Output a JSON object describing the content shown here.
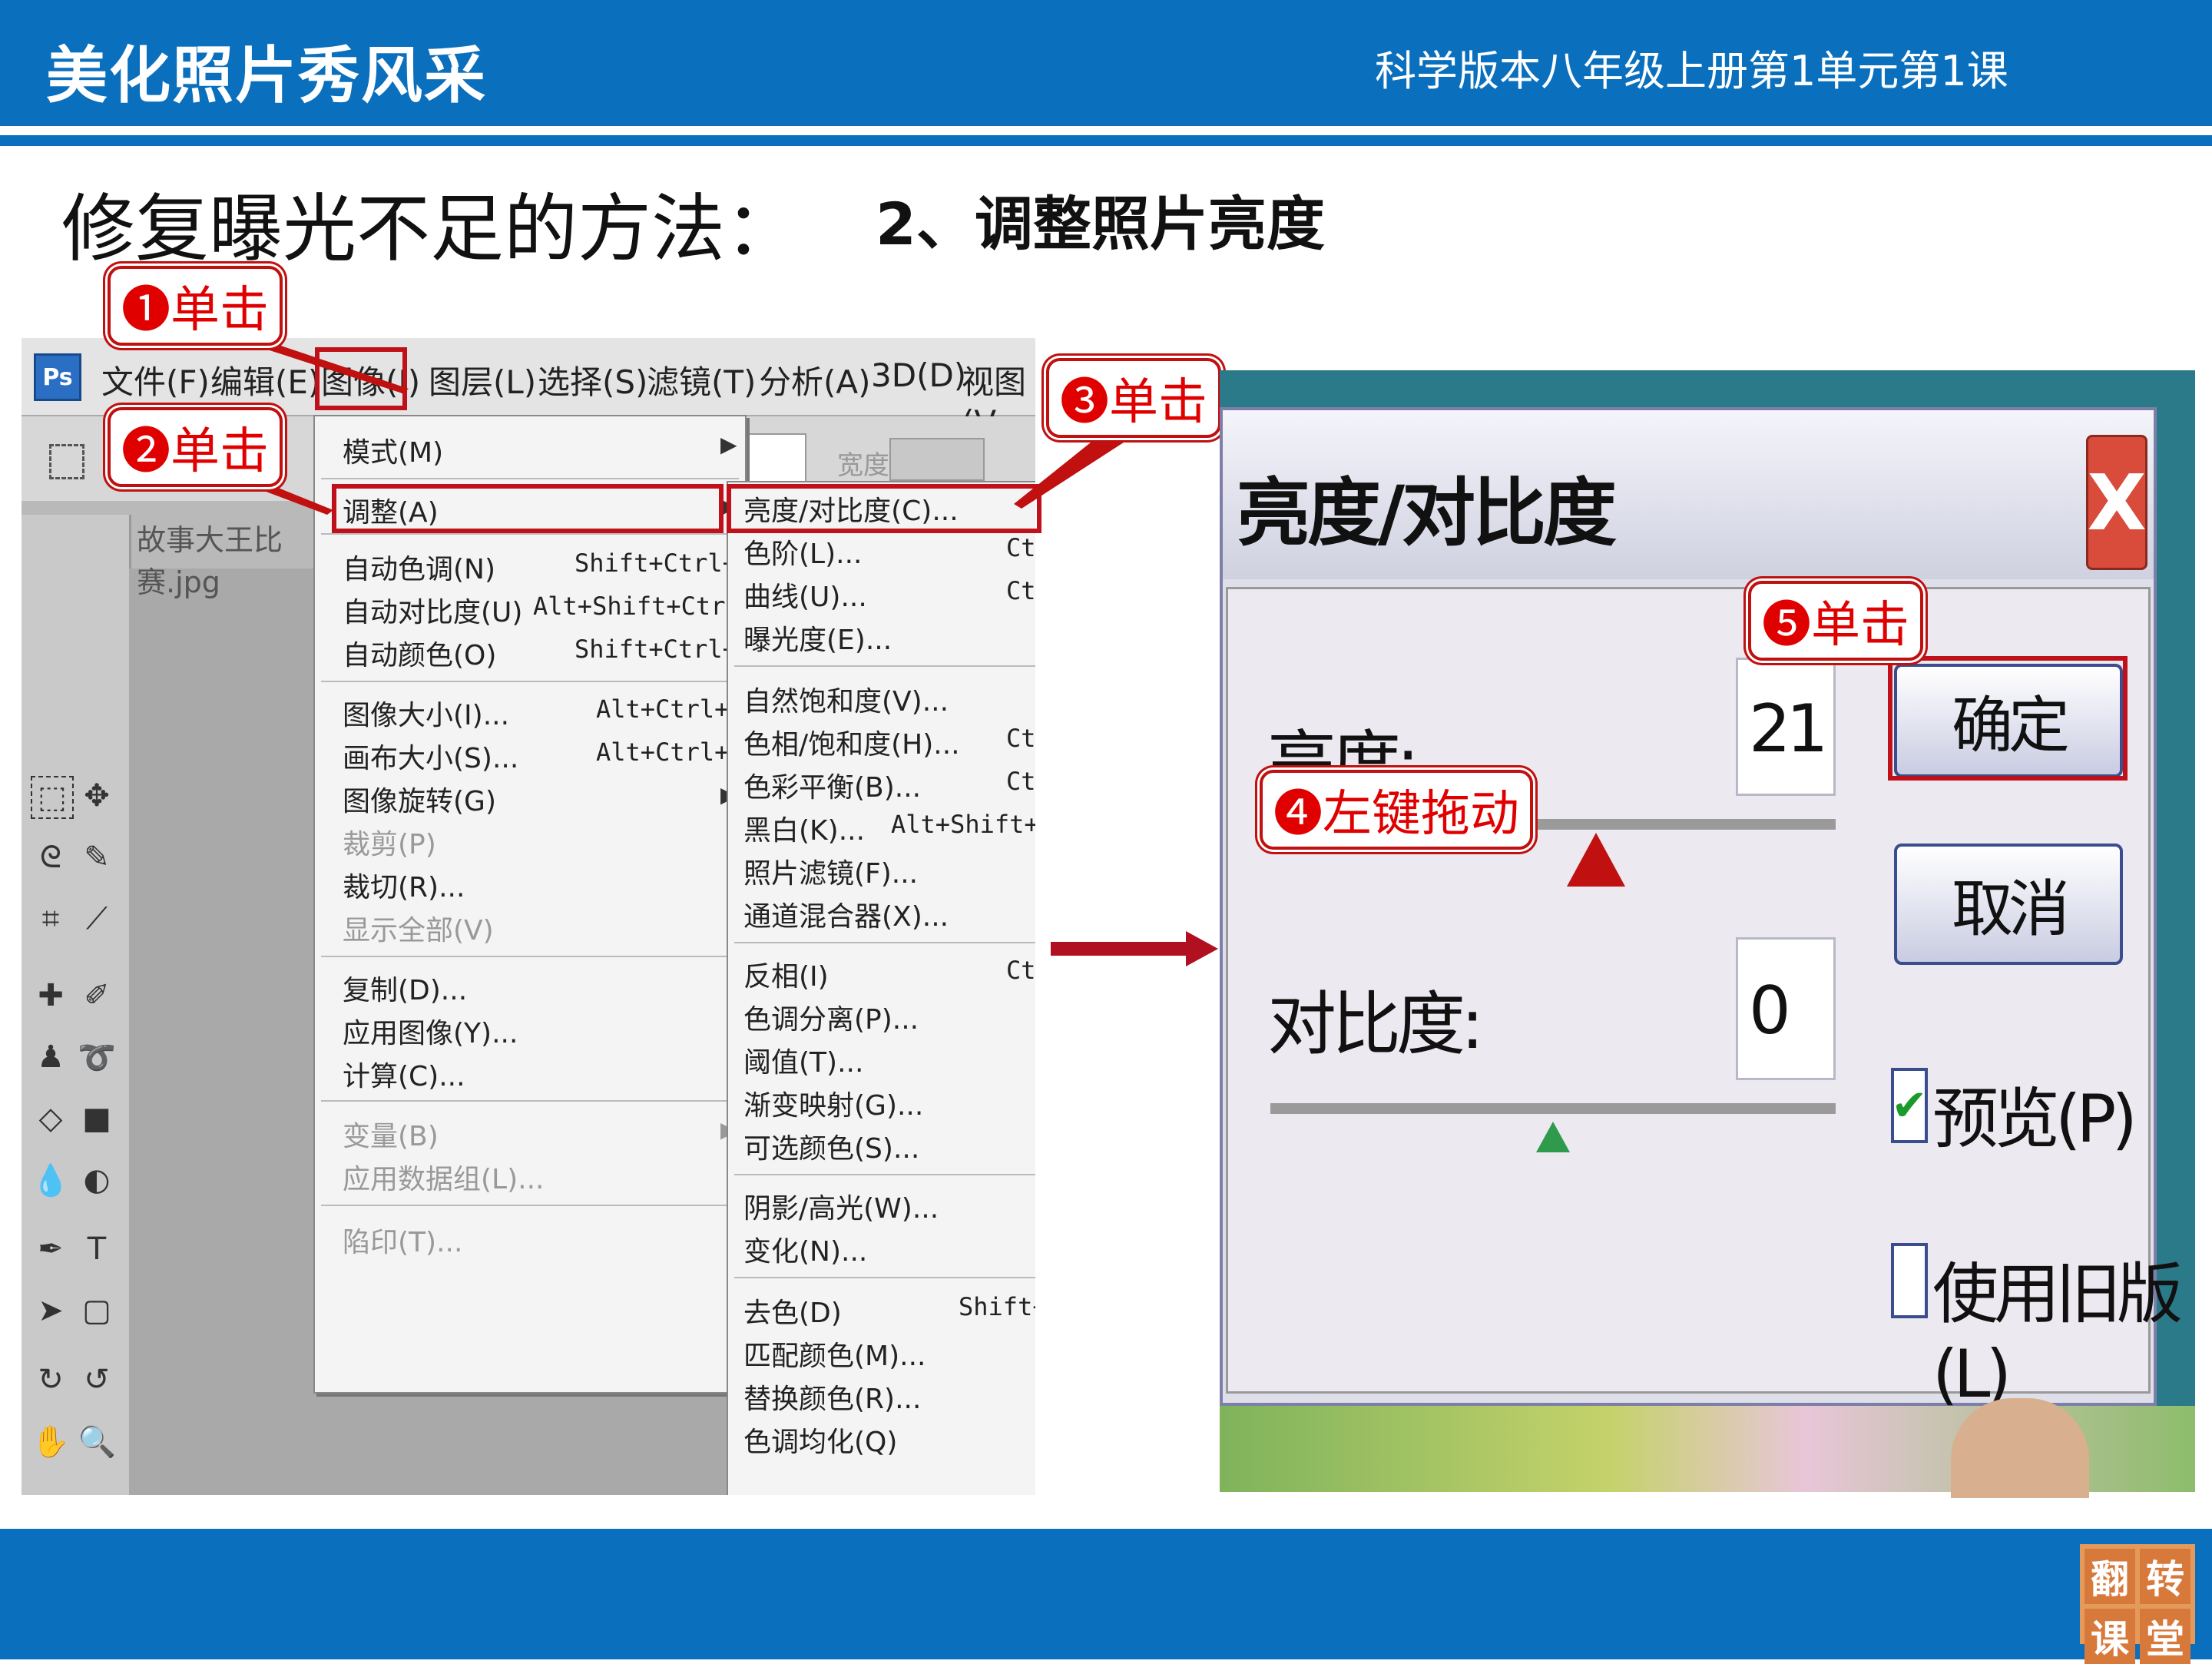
{
  "header": {
    "title": "美化照片秀风采",
    "course": "科学版本八年级上册第1单元第1课"
  },
  "heading": {
    "main": "修复曝光不足的方法：",
    "sub": "2、调整照片亮度"
  },
  "callouts": {
    "step1": "❶单击",
    "step2": "❷单击",
    "step3": "❸单击",
    "step4": "❹左键拖动",
    "step5": "❺单击"
  },
  "photoshop": {
    "logo": "Ps",
    "menubar": [
      "文件(F)",
      "编辑(E)",
      "图像(I)",
      "图层(L)",
      "选择(S)",
      "滤镜(T)",
      "分析(A)",
      "3D(D)",
      "视图(V"
    ],
    "tab": "故事大王比赛.jpg",
    "options_label": "宽度:",
    "image_menu": [
      {
        "label": "模式(M)",
        "shortcut": "",
        "submenu": true
      },
      {
        "label": "调整(A)",
        "shortcut": "",
        "submenu": true
      },
      {
        "label": "自动色调(N)",
        "shortcut": "Shift+Ctrl+L"
      },
      {
        "label": "自动对比度(U)",
        "shortcut": "Alt+Shift+Ctrl+L"
      },
      {
        "label": "自动颜色(O)",
        "shortcut": "Shift+Ctrl+B"
      },
      {
        "label": "图像大小(I)...",
        "shortcut": "Alt+Ctrl+I"
      },
      {
        "label": "画布大小(S)...",
        "shortcut": "Alt+Ctrl+C"
      },
      {
        "label": "图像旋转(G)",
        "shortcut": "",
        "submenu": true
      },
      {
        "label": "裁剪(P)",
        "shortcut": "",
        "disabled": true
      },
      {
        "label": "裁切(R)...",
        "shortcut": ""
      },
      {
        "label": "显示全部(V)",
        "shortcut": "",
        "disabled": true
      },
      {
        "label": "复制(D)...",
        "shortcut": ""
      },
      {
        "label": "应用图像(Y)...",
        "shortcut": ""
      },
      {
        "label": "计算(C)...",
        "shortcut": ""
      },
      {
        "label": "变量(B)",
        "shortcut": "",
        "disabled": true,
        "submenu": true
      },
      {
        "label": "应用数据组(L)...",
        "shortcut": "",
        "disabled": true
      },
      {
        "label": "陷印(T)...",
        "shortcut": "",
        "disabled": true
      }
    ],
    "adjust_menu": [
      {
        "label": "亮度/对比度(C)...",
        "shortcut": ""
      },
      {
        "label": "色阶(L)...",
        "shortcut": "Ct"
      },
      {
        "label": "曲线(U)...",
        "shortcut": "Ct"
      },
      {
        "label": "曝光度(E)...",
        "shortcut": ""
      },
      {
        "label": "自然饱和度(V)...",
        "shortcut": ""
      },
      {
        "label": "色相/饱和度(H)...",
        "shortcut": "Ct"
      },
      {
        "label": "色彩平衡(B)...",
        "shortcut": "Ct"
      },
      {
        "label": "黑白(K)...",
        "shortcut": "Alt+Shift+Ct"
      },
      {
        "label": "照片滤镜(F)...",
        "shortcut": ""
      },
      {
        "label": "通道混合器(X)...",
        "shortcut": ""
      },
      {
        "label": "反相(I)",
        "shortcut": "Ct"
      },
      {
        "label": "色调分离(P)...",
        "shortcut": ""
      },
      {
        "label": "阈值(T)...",
        "shortcut": ""
      },
      {
        "label": "渐变映射(G)...",
        "shortcut": ""
      },
      {
        "label": "可选颜色(S)...",
        "shortcut": ""
      },
      {
        "label": "阴影/高光(W)...",
        "shortcut": ""
      },
      {
        "label": "变化(N)...",
        "shortcut": ""
      },
      {
        "label": "去色(D)",
        "shortcut": "Shift+Ct"
      },
      {
        "label": "匹配颜色(M)...",
        "shortcut": ""
      },
      {
        "label": "替换颜色(R)...",
        "shortcut": ""
      },
      {
        "label": "色调均化(Q)",
        "shortcut": ""
      }
    ]
  },
  "dialog": {
    "title": "亮度/对比度",
    "close": "X",
    "brightness_label": "亮度:",
    "brightness_value": "21",
    "contrast_label": "对比度:",
    "contrast_value": "0",
    "ok": "确定",
    "cancel": "取消",
    "preview_label": "预览(P)",
    "preview_checked": true,
    "legacy_label": "使用旧版(L)",
    "legacy_checked": false
  },
  "logo": [
    "翻",
    "转",
    "课",
    "堂"
  ],
  "colors": {
    "brand_blue": "#0a6fbd",
    "callout_red": "#c01010",
    "logo_orange": "#e39a5b"
  }
}
